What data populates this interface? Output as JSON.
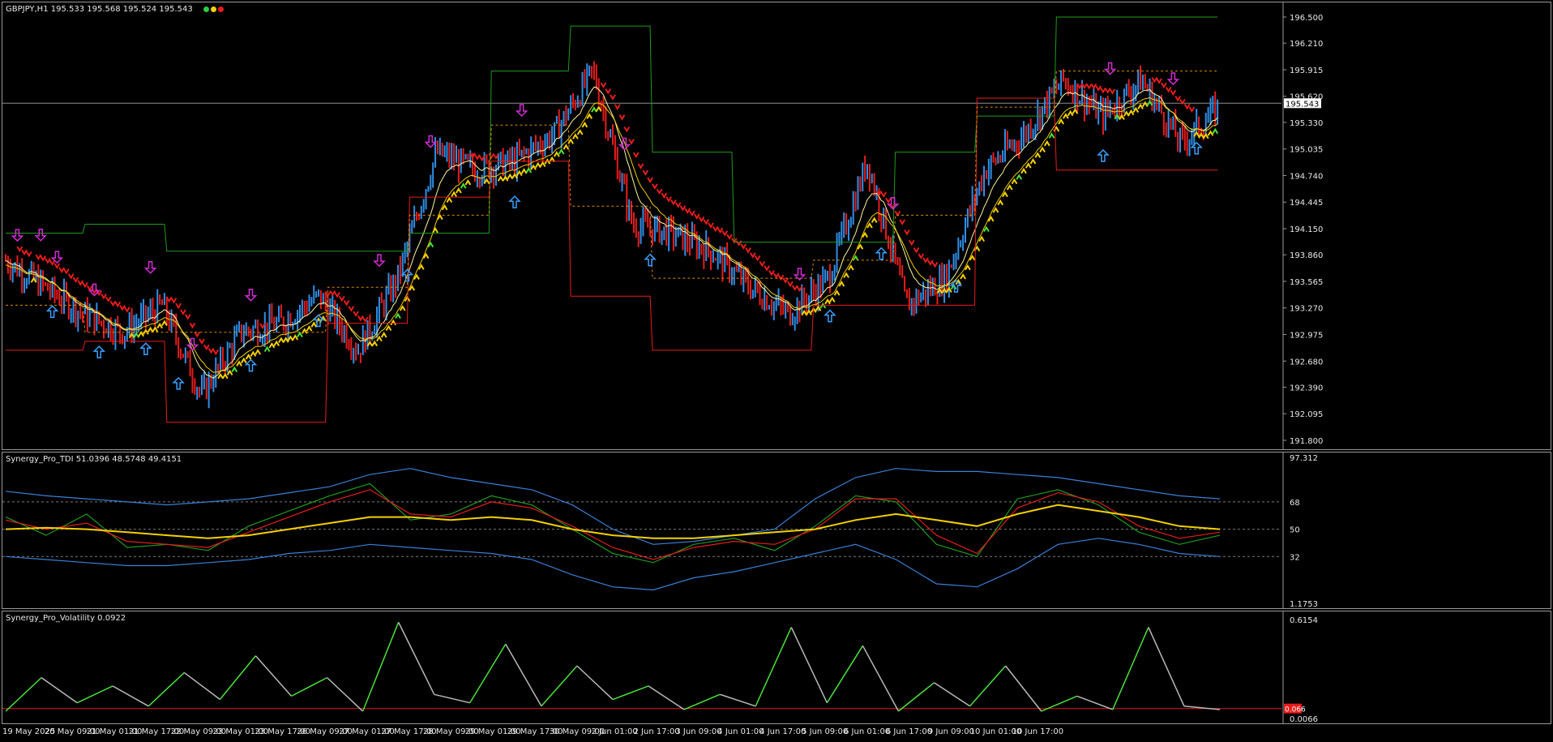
{
  "main_pane": {
    "label": "GBPJPY,H1  195.533 195.568 195.524 195.543",
    "status_dots": [
      "#2ecc40",
      "#f4d000",
      "#e81c1c"
    ],
    "price_levels": [
      "196.500",
      "196.210",
      "195.915",
      "195.620",
      "195.330",
      "195.035",
      "194.740",
      "194.445",
      "194.150",
      "193.860",
      "193.565",
      "193.270",
      "192.975",
      "192.680",
      "192.390",
      "192.095",
      "191.800"
    ],
    "current_price": "195.543"
  },
  "tdi_pane": {
    "label": "Synergy_Pro_TDI 51.0396 48.5748 49.4151",
    "levels": [
      "97.312",
      "68",
      "50",
      "32",
      "1.1753"
    ]
  },
  "vol_pane": {
    "label": "Synergy_Pro_Volatility 0.0922",
    "levels": [
      "0.6154",
      "0.0066"
    ],
    "threshold_value": "0.066"
  },
  "time_axis": [
    "19 May 2025",
    "20 May 09:00",
    "21 May 01:00",
    "21 May 17:00",
    "22 May 09:00",
    "23 May 01:00",
    "23 May 17:00",
    "26 May 09:00",
    "27 May 01:00",
    "27 May 17:00",
    "28 May 09:00",
    "29 May 01:00",
    "29 May 17:00",
    "30 May 09:00",
    "2 Jun 01:00",
    "2 Jun 17:00",
    "3 Jun 09:00",
    "4 Jun 01:00",
    "4 Jun 17:00",
    "5 Jun 09:00",
    "6 Jun 01:00",
    "6 Jun 17:00",
    "9 Jun 09:00",
    "10 Jun 01:00",
    "10 Jun 17:00"
  ],
  "chart_data": [
    {
      "type": "bar",
      "title": "GBPJPY,H1",
      "ylim": [
        191.8,
        196.5
      ],
      "x": [
        "19 May 2025",
        "20 May 09:00",
        "21 May 01:00",
        "21 May 17:00",
        "22 May 09:00",
        "23 May 01:00",
        "23 May 17:00",
        "26 May 09:00",
        "27 May 01:00",
        "27 May 17:00",
        "28 May 09:00",
        "29 May 01:00",
        "29 May 17:00",
        "30 May 09:00",
        "2 Jun 01:00",
        "2 Jun 17:00",
        "3 Jun 09:00",
        "4 Jun 01:00",
        "4 Jun 17:00",
        "5 Jun 09:00",
        "6 Jun 01:00",
        "6 Jun 17:00",
        "9 Jun 09:00",
        "10 Jun 01:00",
        "10 Jun 17:00"
      ],
      "close_path": [
        193.8,
        193.5,
        193.2,
        193.0,
        193.3,
        192.3,
        193.0,
        193.1,
        193.4,
        192.8,
        193.6,
        195.0,
        194.8,
        194.9,
        195.2,
        195.9,
        194.2,
        194.1,
        193.9,
        193.5,
        193.2,
        193.6,
        194.9,
        193.3,
        193.6,
        194.8,
        195.2,
        195.8,
        195.4,
        195.8,
        195.1,
        195.5
      ],
      "colors": {
        "up": "#2f8fe8",
        "down": "#e81c1c",
        "bull_arrow": "#f4d000",
        "buy_arrow": "#3aa0ff",
        "sell_arrow": "#d42bd6",
        "support": "#ff3a3a",
        "resistance": "#22c35e"
      }
    },
    {
      "type": "line",
      "title": "Synergy_Pro_TDI",
      "ylim": [
        1.1753,
        97.312
      ],
      "levels": [
        32,
        50,
        68
      ],
      "series": [
        {
          "name": "upper-band",
          "color": "#3a7fd8",
          "values": [
            75,
            72,
            70,
            68,
            66,
            68,
            70,
            74,
            78,
            86,
            90,
            84,
            80,
            76,
            66,
            50,
            40,
            42,
            46,
            50,
            70,
            84,
            90,
            88,
            88,
            86,
            84,
            80,
            76,
            72,
            70
          ]
        },
        {
          "name": "price-line",
          "color": "#1e9b1e",
          "values": [
            58,
            46,
            60,
            38,
            40,
            36,
            52,
            62,
            72,
            80,
            56,
            60,
            72,
            66,
            50,
            34,
            28,
            40,
            44,
            36,
            52,
            72,
            68,
            40,
            32,
            70,
            76,
            66,
            48,
            40,
            46
          ]
        },
        {
          "name": "signal-line",
          "color": "#e81c1c",
          "values": [
            56,
            50,
            54,
            42,
            40,
            38,
            48,
            58,
            68,
            76,
            60,
            58,
            68,
            64,
            52,
            38,
            30,
            38,
            42,
            40,
            50,
            70,
            70,
            46,
            34,
            64,
            74,
            68,
            52,
            44,
            48
          ]
        },
        {
          "name": "market-base",
          "color": "#f4d000",
          "values": [
            50,
            51,
            50,
            48,
            46,
            44,
            46,
            50,
            54,
            58,
            58,
            56,
            58,
            56,
            50,
            46,
            44,
            44,
            46,
            48,
            50,
            56,
            60,
            56,
            52,
            60,
            66,
            62,
            58,
            52,
            50
          ]
        },
        {
          "name": "lower-band",
          "color": "#3a7fd8",
          "values": [
            32,
            30,
            28,
            26,
            26,
            28,
            30,
            34,
            36,
            40,
            38,
            36,
            34,
            30,
            20,
            12,
            10,
            18,
            22,
            28,
            34,
            40,
            30,
            14,
            12,
            24,
            40,
            44,
            40,
            34,
            32
          ]
        }
      ]
    },
    {
      "type": "line",
      "title": "Synergy_Pro_Volatility",
      "ylim": [
        0.0066,
        0.6154
      ],
      "threshold": 0.066,
      "series": [
        {
          "name": "volatility",
          "colors": [
            "#49e23a",
            "#b9b9b9"
          ],
          "values": [
            0.05,
            0.25,
            0.1,
            0.2,
            0.08,
            0.28,
            0.12,
            0.38,
            0.14,
            0.25,
            0.05,
            0.58,
            0.15,
            0.1,
            0.45,
            0.08,
            0.32,
            0.12,
            0.2,
            0.06,
            0.15,
            0.08,
            0.55,
            0.1,
            0.44,
            0.05,
            0.22,
            0.08,
            0.32,
            0.05,
            0.14,
            0.06,
            0.55,
            0.08,
            0.06
          ]
        }
      ]
    }
  ]
}
